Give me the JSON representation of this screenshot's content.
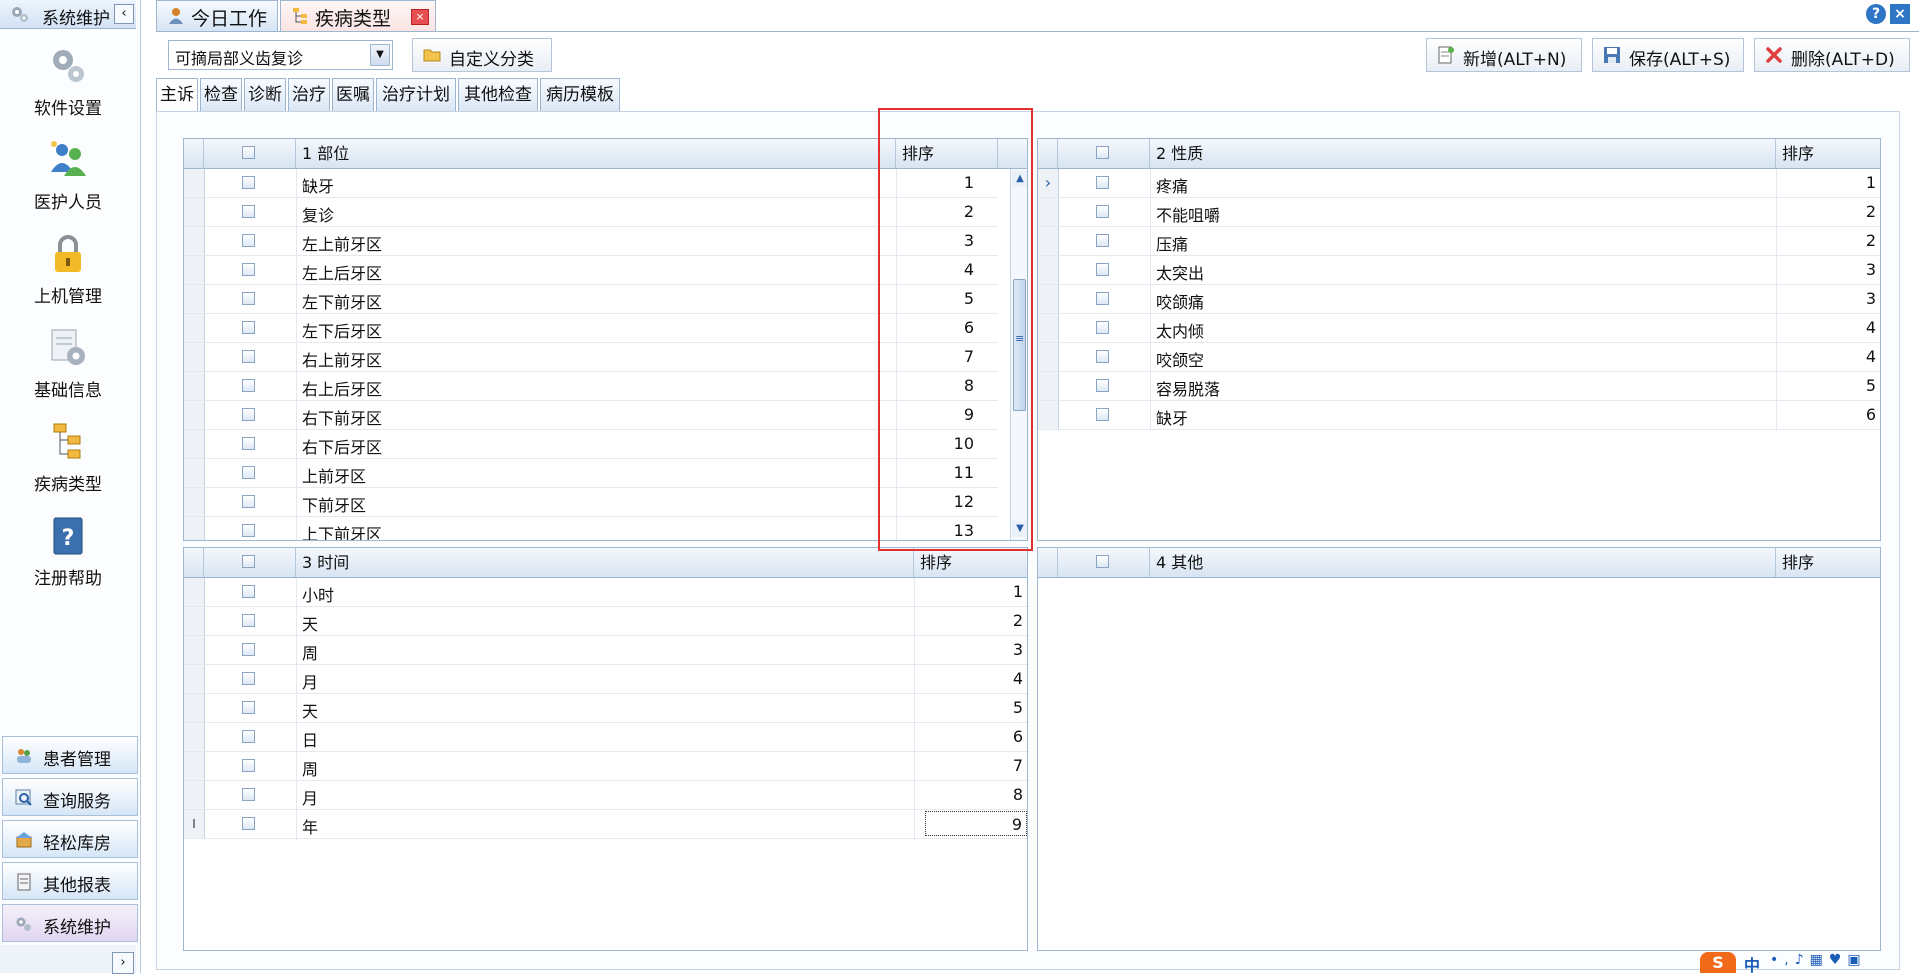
{
  "sidebar": {
    "title": "系统维护",
    "collapse_glyph": "‹",
    "expand_glyph": "›",
    "nav": [
      {
        "label": "软件设置",
        "icon": "gears-icon"
      },
      {
        "label": "医护人员",
        "icon": "staff-icon"
      },
      {
        "label": "上机管理",
        "icon": "lock-icon"
      },
      {
        "label": "基础信息",
        "icon": "info-settings-icon"
      },
      {
        "label": "疾病类型",
        "icon": "tree-icon"
      },
      {
        "label": "注册帮助",
        "icon": "help-book-icon"
      }
    ],
    "accordion": [
      {
        "label": "患者管理",
        "icon": "patients-icon"
      },
      {
        "label": "查询服务",
        "icon": "query-icon"
      },
      {
        "label": "轻松库房",
        "icon": "warehouse-icon"
      },
      {
        "label": "其他报表",
        "icon": "report-icon"
      },
      {
        "label": "系统维护",
        "icon": "gears-icon"
      }
    ]
  },
  "doc_tabs": [
    {
      "label": "今日工作",
      "icon": "worker-icon"
    },
    {
      "label": "疾病类型",
      "icon": "tree-icon",
      "close": "×"
    }
  ],
  "window_controls": {
    "help": "?",
    "close": "×"
  },
  "toolbar": {
    "combo_value": "可摘局部义齿复诊",
    "combo_arrow": "▼",
    "custom_button": "自定义分类",
    "add_button": "新增(ALT+N)",
    "save_button": "保存(ALT+S)",
    "delete_button": "删除(ALT+D)"
  },
  "sub_tabs": [
    "主诉",
    "检查",
    "诊断",
    "治疗",
    "医嘱",
    "治疗计划",
    "其他检查",
    "病历模板"
  ],
  "grids": {
    "g1": {
      "title": "1 部位",
      "sort_header": "排序",
      "rows": [
        {
          "name": "缺牙",
          "sort": "1"
        },
        {
          "name": "复诊",
          "sort": "2"
        },
        {
          "name": "左上前牙区",
          "sort": "3"
        },
        {
          "name": "左上后牙区",
          "sort": "4"
        },
        {
          "name": "左下前牙区",
          "sort": "5"
        },
        {
          "name": "左下后牙区",
          "sort": "6"
        },
        {
          "name": "右上前牙区",
          "sort": "7"
        },
        {
          "name": "右上后牙区",
          "sort": "8"
        },
        {
          "name": "右下前牙区",
          "sort": "9"
        },
        {
          "name": "右下后牙区",
          "sort": "10"
        },
        {
          "name": "上前牙区",
          "sort": "11"
        },
        {
          "name": "下前牙区",
          "sort": "12"
        },
        {
          "name": "上下前牙区",
          "sort": "13"
        }
      ]
    },
    "g2": {
      "title": "2 性质",
      "sort_header": "排序",
      "rows": [
        {
          "name": "疼痛",
          "sort": "1"
        },
        {
          "name": "不能咀嚼",
          "sort": "2"
        },
        {
          "name": "压痛",
          "sort": "2"
        },
        {
          "name": "太突出",
          "sort": "3"
        },
        {
          "name": "咬颌痛",
          "sort": "3"
        },
        {
          "name": "太内倾",
          "sort": "4"
        },
        {
          "name": "咬颌空",
          "sort": "4"
        },
        {
          "name": "容易脱落",
          "sort": "5"
        },
        {
          "name": "缺牙",
          "sort": "6"
        }
      ]
    },
    "g3": {
      "title": "3 时间",
      "sort_header": "排序",
      "rows": [
        {
          "name": "小时",
          "sort": "1"
        },
        {
          "name": "天",
          "sort": "2"
        },
        {
          "name": "周",
          "sort": "3"
        },
        {
          "name": "月",
          "sort": "4"
        },
        {
          "name": "天",
          "sort": "5"
        },
        {
          "name": "日",
          "sort": "6"
        },
        {
          "name": "周",
          "sort": "7"
        },
        {
          "name": "月",
          "sort": "8"
        },
        {
          "name": "年",
          "sort": "9"
        }
      ]
    },
    "g4": {
      "title": "4 其他",
      "sort_header": "排序",
      "rows": []
    }
  },
  "row_pointer_glyph": "›",
  "edit_cursor_glyph": "I",
  "scroll": {
    "up": "▲",
    "down": "▼",
    "grip": "≡"
  },
  "ime": {
    "logo": "S",
    "lang": "中",
    "tools": "•,♪▦♥▣"
  },
  "colors": {
    "highlight": "#e03030",
    "accent": "#2f76c6"
  }
}
